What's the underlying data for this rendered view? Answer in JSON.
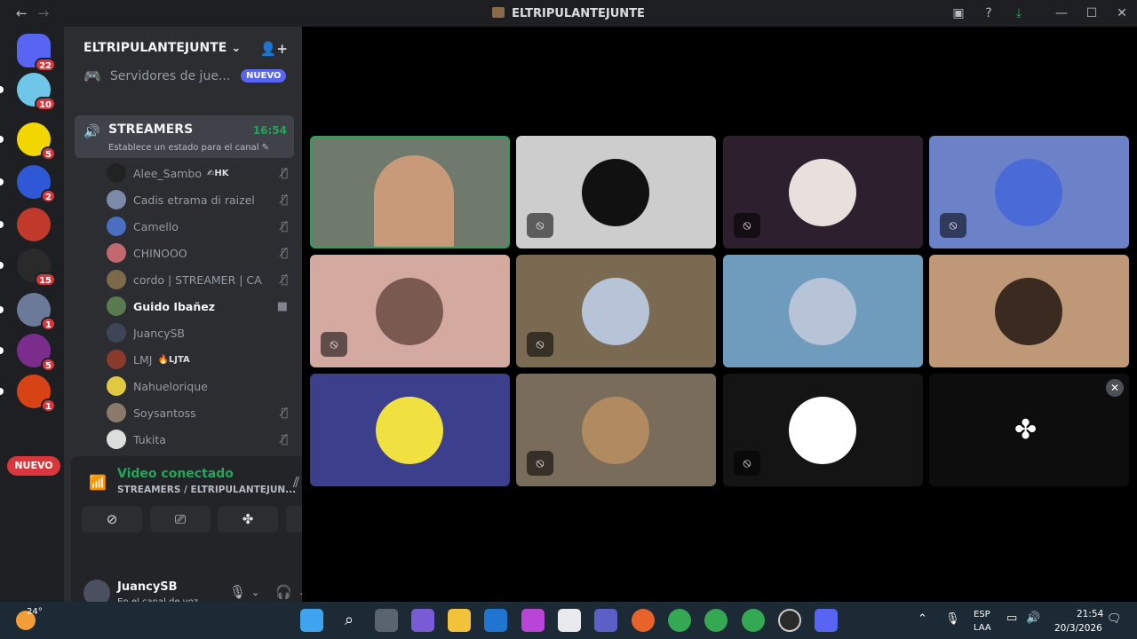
{
  "titlebar": {
    "back": "←",
    "forward": "→",
    "title": "ELTRIPULANTEJUNTE",
    "inbox_icon": "inbox-icon",
    "help": "?",
    "download": "⤓",
    "minimize": "—",
    "maximize": "☐",
    "close": "✕"
  },
  "guilds": [
    {
      "name": "direct-messages",
      "badge": "22",
      "color": "#5865f2"
    },
    {
      "name": "server-blue-face",
      "badge": "10",
      "color": "#6ec6e9"
    },
    {
      "name": "server-yellow-ring",
      "badge": "5",
      "color": "#f2d600"
    },
    {
      "name": "server-star",
      "badge": "2",
      "color": "#2e58d6"
    },
    {
      "name": "server-tripulantejunte",
      "badge": "",
      "color": "#c0392b"
    },
    {
      "name": "server-dark",
      "badge": "15",
      "color": "#2a2a2a"
    },
    {
      "name": "server-gamer",
      "badge": "1",
      "color": "#6b7a99"
    },
    {
      "name": "server-zona-chilena",
      "badge": "5",
      "color": "#7b2d8e"
    },
    {
      "name": "server-red-logo",
      "badge": "1",
      "color": "#d84315"
    }
  ],
  "guild_new_label": "NUEVO",
  "server": {
    "name": "ELTRIPULANTEJUNTE",
    "chevron": "⌄",
    "category_label": "Servidores de jue...",
    "category_badge": "NUEVO"
  },
  "voice_channel": {
    "name": "STREAMERS",
    "time": "16:54",
    "status_hint": "Establece un estado para el canal ✎"
  },
  "members": [
    {
      "name": "Alee_Sambo",
      "tag": "✍HK",
      "icon": "🎙̸",
      "avatar": "#222",
      "active": false
    },
    {
      "name": "Cadis etrama di raizel",
      "tag": "",
      "icon": "🎙̸",
      "avatar": "#7a8aa8",
      "active": false
    },
    {
      "name": "Camello",
      "tag": "",
      "icon": "🎙̸",
      "avatar": "#4a6ec0",
      "active": false
    },
    {
      "name": "CHINOOO",
      "tag": "",
      "icon": "🎙̸",
      "avatar": "#c0696f",
      "active": false
    },
    {
      "name": "cordo | STREAMER | CA...",
      "tag": "",
      "icon": "🎙̸",
      "avatar": "#7d6a4a",
      "active": false
    },
    {
      "name": "Guido Ibañez",
      "tag": "",
      "icon": "■",
      "avatar": "#5a7a50",
      "active": true
    },
    {
      "name": "JuancySB",
      "tag": "",
      "icon": "",
      "avatar": "#3d4556",
      "active": false
    },
    {
      "name": "LMJ",
      "tag": "🔥LJTA",
      "icon": "",
      "avatar": "#8a3a2a",
      "active": false
    },
    {
      "name": "Nahuelorique",
      "tag": "",
      "icon": "",
      "avatar": "#e0c840",
      "active": false
    },
    {
      "name": "Soysantoss",
      "tag": "",
      "icon": "🎙̸",
      "avatar": "#8a7a6a",
      "active": false
    },
    {
      "name": "Tukita",
      "tag": "",
      "icon": "🎙̸",
      "avatar": "#dddddd",
      "active": false
    }
  ],
  "connection": {
    "status": "Video conectado",
    "location": "STREAMERS / ELTRIPULANTEJUN...",
    "buttons": [
      "camera-off-icon",
      "screen-share-icon",
      "activities-icon",
      "soundboard-icon"
    ]
  },
  "user": {
    "name": "JuancySB",
    "status": "En el canal de voz"
  },
  "tiles": [
    {
      "bg": "#6f7a6c",
      "muted": false,
      "live": true,
      "avatar": "#c89a7a"
    },
    {
      "bg": "#cdcdcd",
      "muted": true,
      "avatar": "#111"
    },
    {
      "bg": "#2e1f2e",
      "muted": true,
      "avatar": "#e8e0dc"
    },
    {
      "bg": "#6b82c9",
      "muted": true,
      "avatar": "#4a6ad8"
    },
    {
      "bg": "#d4a9a0",
      "muted": true,
      "avatar": "#7a5a50"
    },
    {
      "bg": "#7a6a52",
      "muted": true,
      "avatar": "#b7c3d6"
    },
    {
      "bg": "#6f9cbd",
      "muted": false,
      "avatar": "#b7c3d6"
    },
    {
      "bg": "#bf9878",
      "muted": false,
      "avatar": "#3a2a20"
    },
    {
      "bg": "#3c3f8c",
      "muted": false,
      "avatar": "#f0e040"
    },
    {
      "bg": "#7a6c5a",
      "muted": true,
      "avatar": "#b08a60"
    },
    {
      "bg": "#141414",
      "muted": true,
      "avatar": "#ffffff"
    },
    {
      "bg": "#0d0d0d",
      "muted": false,
      "activity": true,
      "avatar": ""
    }
  ],
  "taskbar": {
    "weather_temp": "24°",
    "lang": "ESP",
    "lang2": "LAA",
    "time": "21:54",
    "date": "20/3/2026"
  }
}
